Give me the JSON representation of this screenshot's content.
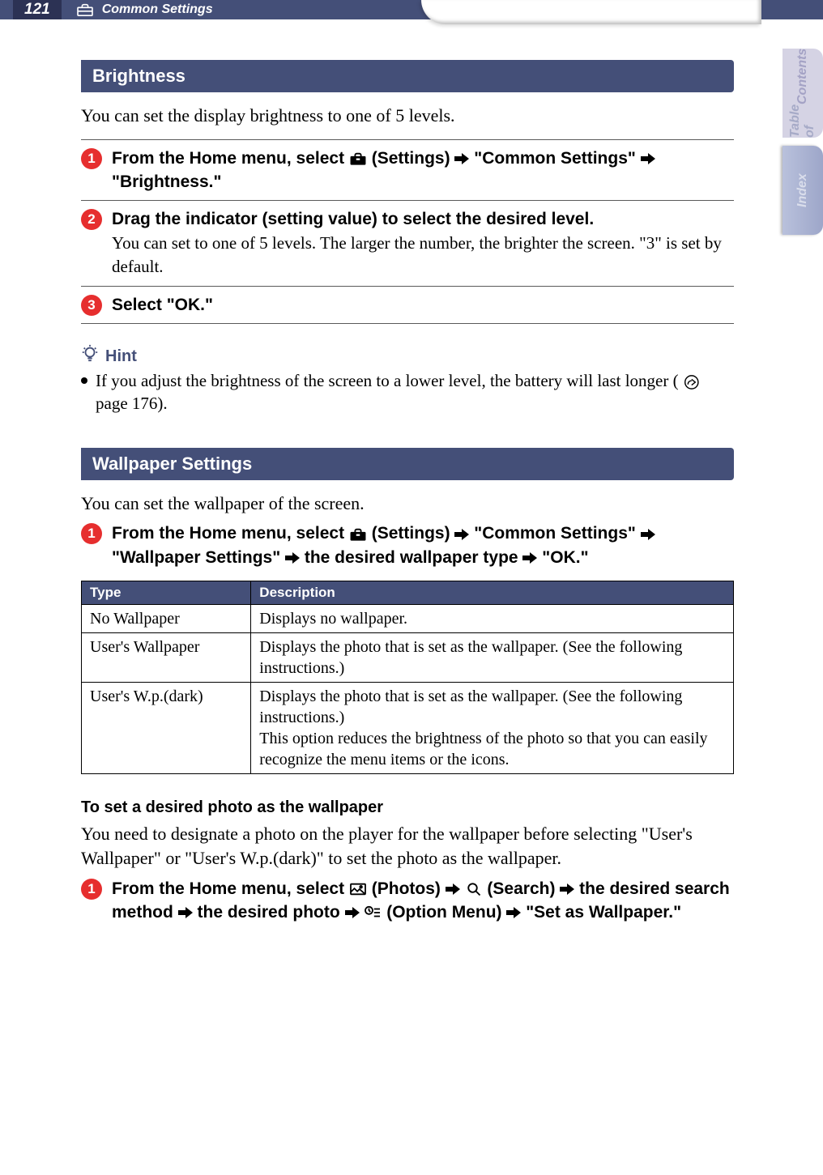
{
  "header": {
    "page_number": "121",
    "section": "Common Settings"
  },
  "sidetabs": {
    "toc_line1": "Table of",
    "toc_line2": "Contents",
    "index": "Index"
  },
  "brightness": {
    "title": "Brightness",
    "intro": "You can set the display brightness to one of 5 levels.",
    "steps": {
      "s1": {
        "num": "1",
        "t1": "From the Home menu, select ",
        "t2": " (Settings) ",
        "t3": " \"Common Settings\" ",
        "t4": " \"Brightness.\""
      },
      "s2": {
        "num": "2",
        "title": "Drag the indicator (setting value) to select the desired level.",
        "detail": "You can set to one of 5 levels. The larger the number, the brighter the screen. \"3\" is set by default."
      },
      "s3": {
        "num": "3",
        "title": "Select \"OK.\""
      }
    },
    "hint_label": "Hint",
    "hint_t1": "If you adjust the brightness of the screen to a lower level, the battery will last longer (",
    "hint_t2": " page 176)."
  },
  "wallpaper": {
    "title": "Wallpaper Settings",
    "intro": "You can set the wallpaper of the screen.",
    "step1": {
      "num": "1",
      "t1": "From the Home menu, select ",
      "t2": " (Settings) ",
      "t3": " \"Common Settings\" ",
      "t4": " \"Wallpaper Settings\" ",
      "t5": " the desired wallpaper type ",
      "t6": " \"OK.\""
    },
    "table": {
      "h1": "Type",
      "h2": "Description",
      "rows": [
        {
          "type": "No Wallpaper",
          "desc": "Displays no wallpaper."
        },
        {
          "type": "User's Wallpaper",
          "desc": "Displays the photo that is set as the wallpaper. (See the following instructions.)"
        },
        {
          "type": "User's W.p.(dark)",
          "desc": "Displays the photo that is set as the wallpaper. (See the following instructions.)\nThis option reduces the brightness of the photo so that you can easily recognize the menu items or the icons."
        }
      ]
    },
    "subhead": "To set a desired photo as the wallpaper",
    "subintro": "You need to designate a photo on the player for the wallpaper before selecting \"User's Wallpaper\" or \"User's W.p.(dark)\" to set the photo as the wallpaper.",
    "step_photo": {
      "num": "1",
      "t1": "From the Home menu, select ",
      "t2": " (Photos) ",
      "t3": " (Search) ",
      "t4": " the desired search method ",
      "t5": " the desired photo ",
      "t6": " (Option Menu) ",
      "t7": " \"Set as Wallpaper.\""
    }
  }
}
